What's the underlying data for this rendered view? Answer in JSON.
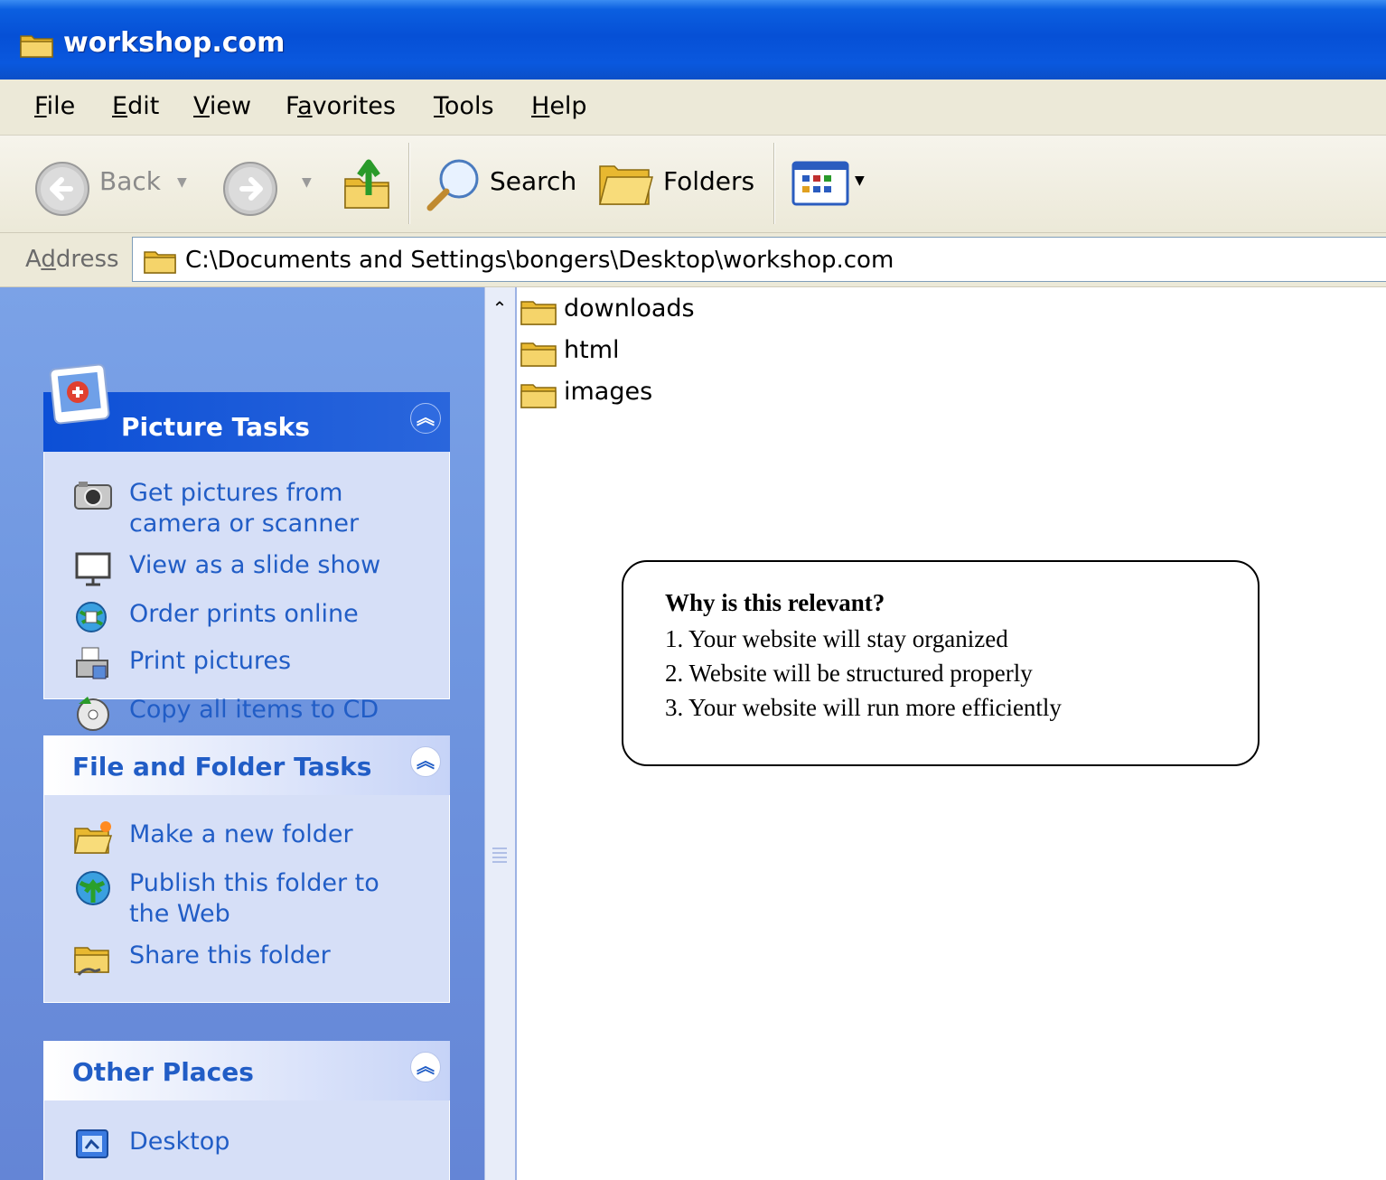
{
  "window": {
    "title": "workshop.com",
    "icon": "folder-icon"
  },
  "menu": [
    {
      "pre": "",
      "u": "F",
      "post": "ile"
    },
    {
      "pre": "",
      "u": "E",
      "post": "dit"
    },
    {
      "pre": "",
      "u": "V",
      "post": "iew"
    },
    {
      "pre": "F",
      "u": "a",
      "post": "vorites"
    },
    {
      "pre": "",
      "u": "T",
      "post": "ools"
    },
    {
      "pre": "",
      "u": "H",
      "post": "elp"
    }
  ],
  "toolbar": {
    "back": "Back",
    "search": "Search",
    "folders": "Folders"
  },
  "address": {
    "label_pre": "A",
    "label_u": "d",
    "label_post": "dress",
    "path": "C:\\Documents and Settings\\bongers\\Desktop\\workshop.com"
  },
  "picture_tasks": {
    "title": "Picture Tasks",
    "items": [
      {
        "label": "Get pictures from camera or scanner",
        "icon": "camera-icon"
      },
      {
        "label": "View as a slide show",
        "icon": "projector-icon"
      },
      {
        "label": "Order prints online",
        "icon": "globe-print-icon"
      },
      {
        "label": "Print pictures",
        "icon": "printer-icon"
      },
      {
        "label": "Copy all items to CD",
        "icon": "cd-icon"
      }
    ]
  },
  "file_tasks": {
    "title": "File and Folder Tasks",
    "items": [
      {
        "label": "Make a new folder",
        "icon": "new-folder-icon"
      },
      {
        "label": "Publish this folder to the Web",
        "icon": "publish-web-icon"
      },
      {
        "label": "Share this folder",
        "icon": "share-folder-icon"
      }
    ]
  },
  "other_places": {
    "title": "Other Places",
    "items": [
      {
        "label": "Desktop",
        "icon": "desktop-icon"
      }
    ]
  },
  "files": [
    "downloads",
    "html",
    "images"
  ],
  "callout": {
    "title": "Why is this relevant?",
    "lines": [
      "1. Your website will stay organized",
      "2. Website will be structured properly",
      "3. Your website will run more efficiently"
    ]
  }
}
